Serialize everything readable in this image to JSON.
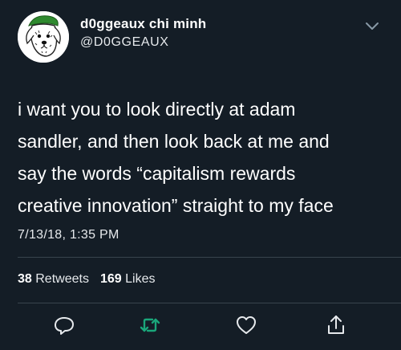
{
  "user": {
    "display_name": "d0ggeaux chi minh",
    "handle": "@D0GGEAUX",
    "avatar_icon": "dog-with-green-beret-avatar"
  },
  "tweet": {
    "text": "i want you to look directly at adam\nsandler, and then look back at me and\nsay the words “capitalism rewards\ncreative innovation” straight to my face",
    "timestamp": "7/13/18, 1:35 PM"
  },
  "stats": {
    "retweets_count": "38",
    "retweets_label": "Retweets",
    "likes_count": "169",
    "likes_label": "Likes"
  },
  "actions": {
    "reply_icon": "reply-icon",
    "retweet_icon": "retweet-icon",
    "like_icon": "heart-icon",
    "share_icon": "share-icon"
  },
  "colors": {
    "background": "#141d26",
    "text": "#ffffff",
    "secondary_text": "#e6e9ec",
    "retweet_green": "#1aa67a",
    "icon_gray": "#e6e9ec",
    "divider": "#38444d"
  }
}
